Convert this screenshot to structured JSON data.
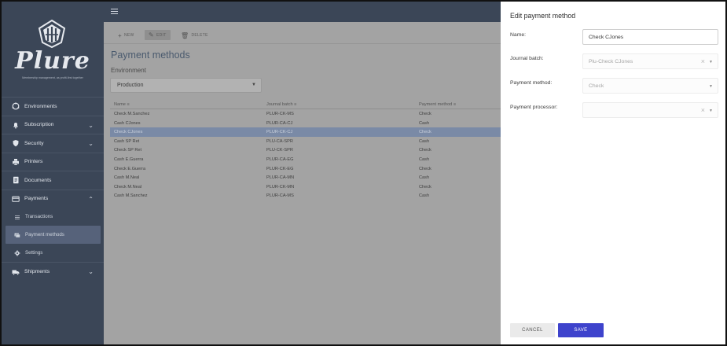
{
  "brand": {
    "name": "Plure",
    "tagline": "Membership management, as profit-first together"
  },
  "sidebar": {
    "items": [
      {
        "label": "Environments",
        "icon": "environments-icon"
      },
      {
        "label": "Subscription",
        "icon": "bell-icon",
        "chevron": "down"
      },
      {
        "label": "Security",
        "icon": "shield-icon",
        "chevron": "down"
      },
      {
        "label": "Printers",
        "icon": "printer-icon"
      },
      {
        "label": "Documents",
        "icon": "document-icon"
      },
      {
        "label": "Payments",
        "icon": "credit-card-icon",
        "chevron": "up"
      },
      {
        "label": "Shipments",
        "icon": "truck-icon",
        "chevron": "down"
      }
    ],
    "payments_sub": [
      {
        "label": "Transactions",
        "icon": "list-icon"
      },
      {
        "label": "Payment methods",
        "icon": "payment-methods-icon",
        "active": true
      },
      {
        "label": "Settings",
        "icon": "gear-icon"
      }
    ]
  },
  "toolbar": {
    "new_label": "NEW",
    "edit_label": "EDIT",
    "delete_label": "DELETE"
  },
  "page": {
    "title": "Payment methods",
    "environment_label": "Environment",
    "environment_value": "Production"
  },
  "table": {
    "headers": [
      "Name",
      "Journal batch",
      "Payment method"
    ],
    "rows": [
      [
        "Check M.Sanchez",
        "PLUR-CK-MS",
        "Check"
      ],
      [
        "Cash CJones",
        "PLUR-CA-CJ",
        "Cash"
      ],
      [
        "Check CJones",
        "PLUR-CK-CJ",
        "Check"
      ],
      [
        "Cash SP Ret",
        "PLU-CA-SPR",
        "Cash"
      ],
      [
        "Check SP Ret",
        "PLU-CK-SPR",
        "Check"
      ],
      [
        "Cash E.Guerra",
        "PLUR-CA-EG",
        "Cash"
      ],
      [
        "Check E.Guerra",
        "PLUR-CK-EG",
        "Check"
      ],
      [
        "Cash M.Neal",
        "PLUR-CA-MN",
        "Cash"
      ],
      [
        "Check M.Neal",
        "PLUR-CK-MN",
        "Check"
      ],
      [
        "Cash M.Sanchez",
        "PLUR-CA-MS",
        "Cash"
      ]
    ],
    "selected_row": 2
  },
  "dialog": {
    "title": "Edit payment method",
    "name_label": "Name:",
    "name_value": "Check CJones",
    "journal_label": "Journal batch:",
    "journal_value": "Plu-Check CJones",
    "method_label": "Payment method:",
    "method_value": "Check",
    "processor_label": "Payment processor:",
    "processor_value": "",
    "cancel_label": "CANCEL",
    "save_label": "SAVE"
  },
  "colors": {
    "sidebar": "#3b4657",
    "accent": "#3e43cc",
    "selected_row": "#7a8aa6"
  }
}
